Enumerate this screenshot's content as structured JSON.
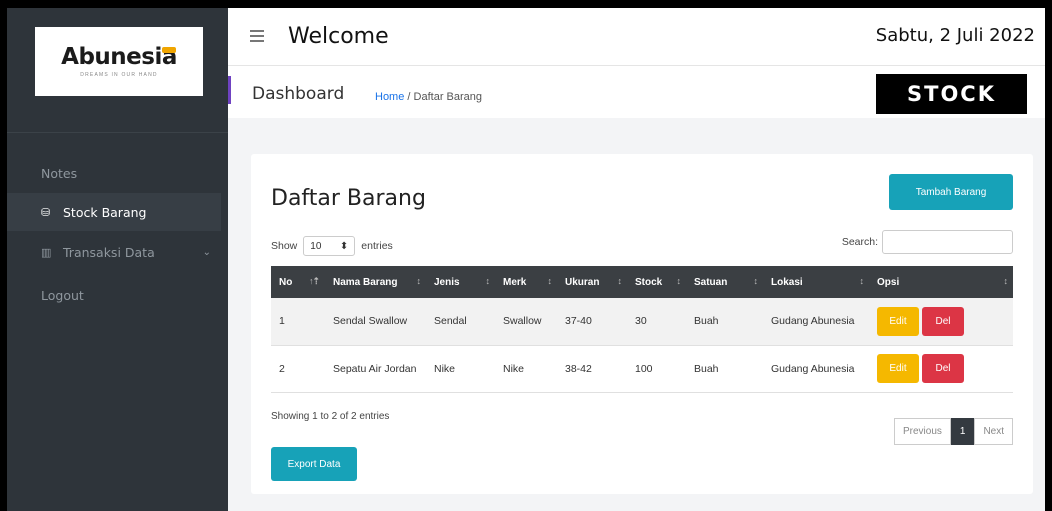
{
  "brand": {
    "name": "Abunesia",
    "tagline": "DREAMS IN OUR HAND",
    "accent": "#f0a500"
  },
  "sidebar": {
    "items": [
      {
        "label": "Notes",
        "icon": "none",
        "active": false
      },
      {
        "label": "Stock Barang",
        "icon": "cube-icon",
        "active": true
      },
      {
        "label": "Transaksi Data",
        "icon": "table-icon",
        "active": false,
        "chevron": "⌄"
      },
      {
        "label": "Logout",
        "icon": "none",
        "active": false
      }
    ]
  },
  "header": {
    "title": "Welcome",
    "date": "Sabtu, 2 Juli 2022"
  },
  "breadcrumb": {
    "page": "Dashboard",
    "home": "Home",
    "sep": "/",
    "current": "Daftar Barang",
    "badge": "STOCK"
  },
  "card": {
    "title": "Daftar Barang",
    "add_button": "Tambah Barang",
    "show_label": "Show",
    "show_value": "10",
    "entries_label": "entries",
    "search_label": "Search:",
    "search_value": "",
    "columns": [
      "No",
      "Nama Barang",
      "Jenis",
      "Merk",
      "Ukuran",
      "Stock",
      "Satuan",
      "Lokasi",
      "Opsi"
    ],
    "rows": [
      {
        "no": "1",
        "nama": "Sendal Swallow",
        "jenis": "Sendal",
        "merk": "Swallow",
        "ukuran": "37-40",
        "stock": "30",
        "satuan": "Buah",
        "lokasi": "Gudang Abunesia"
      },
      {
        "no": "2",
        "nama": "Sepatu Air Jordan",
        "jenis": "Nike",
        "merk": "Nike",
        "ukuran": "38-42",
        "stock": "100",
        "satuan": "Buah",
        "lokasi": "Gudang Abunesia"
      }
    ],
    "edit_label": "Edit",
    "del_label": "Del",
    "info": "Showing 1 to 2 of 2 entries",
    "pagination": {
      "prev": "Previous",
      "page": "1",
      "next": "Next"
    },
    "export_button": "Export Data"
  },
  "colors": {
    "primary": "#17a2b8",
    "warning": "#f5b800",
    "danger": "#dc3545",
    "sidebar": "#2e343a"
  }
}
